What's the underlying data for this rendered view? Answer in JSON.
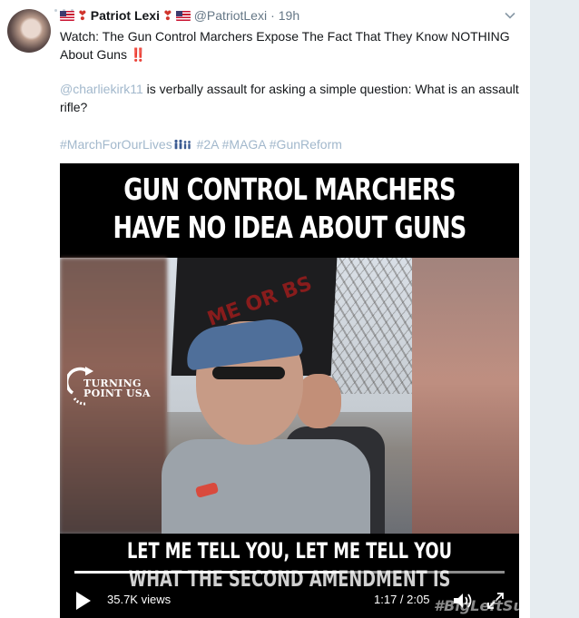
{
  "tweet": {
    "display_name": "Patriot Lexi",
    "handle": "@PatriotLexi",
    "separator": "·",
    "time": "19h",
    "text": "Watch: The Gun Control Marchers Expose The Fact That They Know NOTHING About Guns",
    "text_emoji": "‼️",
    "reply_mention": "@charliekirk11",
    "reply_text": " is verbally assault for asking a simple question: What is an assault rifle?",
    "hashtags": [
      "#MarchForOurLives",
      "#2A",
      "#MAGA",
      "#GunReform"
    ]
  },
  "video": {
    "headline_line1": "GUN CONTROL MARCHERS",
    "headline_line2": "HAVE NO IDEA ABOUT GUNS",
    "logo_line1": "TURNING",
    "logo_line2": "POINT USA",
    "sign_text": "ME OR BS",
    "caption_line1": "LET ME TELL YOU, LET ME TELL YOU",
    "caption_line2": "WHAT THE SECOND AMENDMENT IS",
    "views": "35.7K views",
    "time_current": "1:17",
    "time_separator": " / ",
    "time_total": "2:05",
    "progress_fraction": 0.616,
    "watermark": "#BigLeftSucks"
  },
  "colors": {
    "link": "#a2b8cc",
    "text": "#14171a",
    "muted": "#657786",
    "gutter": "#e6ecf0"
  },
  "icons": [
    "us-flag-icon",
    "red-pin-icon",
    "chevron-down-icon",
    "family-icon",
    "play-icon",
    "volume-icon",
    "fullscreen-icon"
  ]
}
